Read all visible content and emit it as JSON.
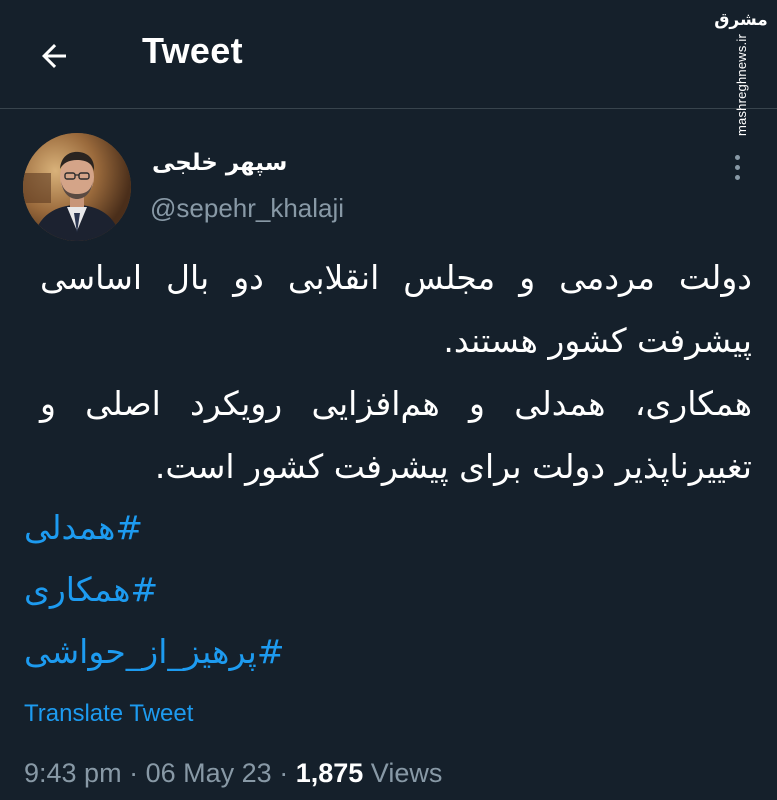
{
  "header": {
    "title": "Tweet"
  },
  "watermark": {
    "logo_text": "مشرق",
    "site": "mashreghnews.ir"
  },
  "tweet": {
    "author": {
      "display_name": "سپهر خلجی",
      "handle": "@sepehr_khalaji"
    },
    "paragraphs": [
      "دولت مردمی و مجلس انقلابی دو بال اساسی پیشرفت کشور هستند.",
      "همکاری، همدلی و هم‌افزایی رویکرد اصلی و تغییرناپذیر دولت برای پیشرفت کشور است."
    ],
    "hashtags": [
      "همدلی#",
      "همکاری#",
      "پرهیز_از_حواشی#"
    ],
    "translate_label": "Translate Tweet",
    "time": "9:43 pm",
    "date": "06 May 23",
    "views_count": "1,875",
    "views_label": "Views"
  },
  "colors": {
    "background": "#15202b",
    "link": "#1d9bf0",
    "muted": "#8899a6",
    "text": "#ffffff",
    "divider": "#38444d"
  },
  "icons": {
    "back": "arrow-left-icon",
    "more": "more-vertical-icon"
  }
}
